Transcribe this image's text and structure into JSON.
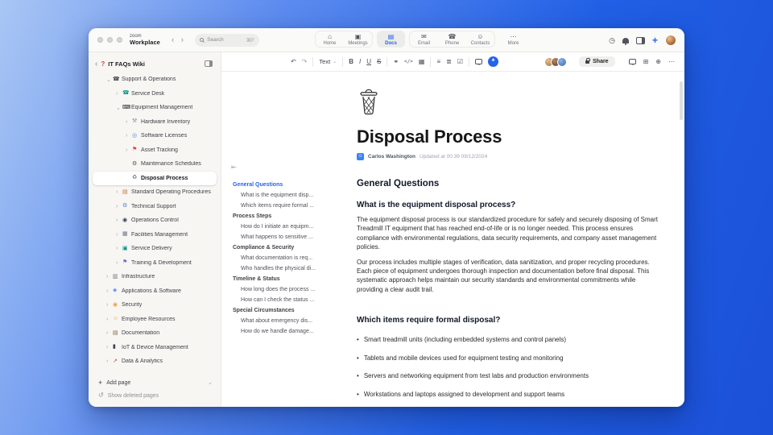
{
  "theme": {
    "accent": "#2563eb",
    "background_top": "#a9c6f4",
    "background_bottom": "#1b50d8"
  },
  "window": {
    "brand": {
      "top": "zoom",
      "bottom": "Workplace"
    },
    "search": {
      "label": "Search",
      "shortcut": "⌘F"
    },
    "nav_tabs": [
      {
        "label": "Home",
        "icon": "home-icon",
        "glyph": "⌂",
        "active": false,
        "group": 0
      },
      {
        "label": "Meetings",
        "icon": "meetings-icon",
        "glyph": "▣",
        "active": false,
        "group": 0
      },
      {
        "label": "Docs",
        "icon": "docs-icon",
        "glyph": "▤",
        "active": true,
        "group": 1
      },
      {
        "label": "Email",
        "icon": "email-icon",
        "glyph": "✉",
        "active": false,
        "group": 2
      },
      {
        "label": "Phone",
        "icon": "phone-icon",
        "glyph": "☎",
        "active": false,
        "group": 2
      },
      {
        "label": "Contacts",
        "icon": "contacts-icon",
        "glyph": "☺",
        "active": false,
        "group": 2
      },
      {
        "label": "More",
        "icon": "more-icon",
        "glyph": "⋯",
        "active": false,
        "group": 3
      }
    ]
  },
  "sidebar": {
    "title": "IT FAQs Wiki",
    "tree": [
      {
        "label": "Support & Operations",
        "depth": 0,
        "chevron": "expanded",
        "glyph": "☎",
        "color": "#3f3f46"
      },
      {
        "label": "Service Desk",
        "depth": 1,
        "chevron": "collapsed",
        "glyph": "☎",
        "color": "#0e9488"
      },
      {
        "label": "Equipment Management",
        "depth": 1,
        "chevron": "expanded",
        "glyph": "⌨",
        "color": "#27272a"
      },
      {
        "label": "Hardware Inventory",
        "depth": 2,
        "chevron": "collapsed",
        "glyph": "⚒",
        "color": "#8a8f98"
      },
      {
        "label": "Software Licenses",
        "depth": 2,
        "chevron": "collapsed",
        "glyph": "◎",
        "color": "#5b7fd4"
      },
      {
        "label": "Asset Tracking",
        "depth": 2,
        "chevron": "collapsed",
        "glyph": "⚑",
        "color": "#e0443a"
      },
      {
        "label": "Maintenance Schedules",
        "depth": 2,
        "chevron": "none",
        "glyph": "⚙",
        "color": "#52525b"
      },
      {
        "label": "Disposal Process",
        "depth": 2,
        "chevron": "none",
        "glyph": "♻",
        "color": "#6b7280",
        "selected": true
      },
      {
        "label": "Standard Operating Procedures",
        "depth": 1,
        "chevron": "collapsed",
        "glyph": "▤",
        "color": "#c2703d"
      },
      {
        "label": "Technical Support",
        "depth": 1,
        "chevron": "collapsed",
        "glyph": "⚙",
        "color": "#5b7fd4"
      },
      {
        "label": "Operations Control",
        "depth": 1,
        "chevron": "collapsed",
        "glyph": "◉",
        "color": "#374151"
      },
      {
        "label": "Facilities Management",
        "depth": 1,
        "chevron": "collapsed",
        "glyph": "▦",
        "color": "#64748b"
      },
      {
        "label": "Service Delivery",
        "depth": 1,
        "chevron": "collapsed",
        "glyph": "▣",
        "color": "#0e9488"
      },
      {
        "label": "Training & Development",
        "depth": 1,
        "chevron": "collapsed",
        "glyph": "⚑",
        "color": "#7c5cd6"
      },
      {
        "label": "Infrastructure",
        "depth": 0,
        "chevron": "collapsed",
        "glyph": "▥",
        "color": "#6b7280"
      },
      {
        "label": "Applications & Software",
        "depth": 0,
        "chevron": "collapsed",
        "glyph": "◈",
        "color": "#3b82f6"
      },
      {
        "label": "Security",
        "depth": 0,
        "chevron": "collapsed",
        "glyph": "◉",
        "color": "#e8a33d"
      },
      {
        "label": "Employee Resources",
        "depth": 0,
        "chevron": "collapsed",
        "glyph": "☺",
        "color": "#d9a520"
      },
      {
        "label": "Documentation",
        "depth": 0,
        "chevron": "collapsed",
        "glyph": "▤",
        "color": "#8b5e3c"
      },
      {
        "label": "IoT & Device Management",
        "depth": 0,
        "chevron": "collapsed",
        "glyph": "▮",
        "color": "#374151"
      },
      {
        "label": "Data & Analytics",
        "depth": 0,
        "chevron": "collapsed",
        "glyph": "↗",
        "color": "#e0443a"
      }
    ],
    "add_page": "Add page",
    "show_deleted": "Show deleted pages"
  },
  "toolbar": {
    "share_label": "Share",
    "items": [
      {
        "name": "undo-icon",
        "glyph": "↶"
      },
      {
        "name": "redo-icon",
        "glyph": "↷",
        "cls": "light"
      },
      {
        "type": "sep"
      },
      {
        "name": "text-style-dropdown",
        "type": "dropdown",
        "label": "Text",
        "chevron": "⌄"
      },
      {
        "type": "sep"
      },
      {
        "name": "bold-button",
        "glyph": "B",
        "cls": "b"
      },
      {
        "name": "italic-button",
        "glyph": "I",
        "cls": "i"
      },
      {
        "name": "underline-button",
        "glyph": "U",
        "cls": "u"
      },
      {
        "name": "strikethrough-button",
        "glyph": "S",
        "cls": "s"
      },
      {
        "type": "sep"
      },
      {
        "name": "link-button",
        "glyph": "⚭"
      },
      {
        "name": "code-button",
        "glyph": "</>",
        "cls": "code"
      },
      {
        "name": "insert-table-button",
        "glyph": "▦"
      },
      {
        "type": "sep"
      },
      {
        "name": "bulleted-list-button",
        "glyph": "≡"
      },
      {
        "name": "numbered-list-button",
        "glyph": "≣"
      },
      {
        "name": "checklist-button",
        "glyph": "☑"
      },
      {
        "type": "sep"
      },
      {
        "name": "comment-button",
        "type": "bubble"
      },
      {
        "name": "ai-assistant-button",
        "type": "ai",
        "glyph": "*"
      }
    ],
    "collaborators": [
      {
        "light": "#eec08e",
        "dark": "#9a6a3e"
      },
      {
        "light": "#b08868",
        "dark": "#5e3d26"
      },
      {
        "light": "#8ab4e8",
        "dark": "#3c6aa8"
      }
    ]
  },
  "toc": {
    "items": [
      {
        "label": "General Questions",
        "level": 0,
        "active": true
      },
      {
        "label": "What is the equipment disp...",
        "level": 1
      },
      {
        "label": "Which items require formal ...",
        "level": 1
      },
      {
        "label": "Process Steps",
        "level": 0
      },
      {
        "label": "How do I initiate an equipm...",
        "level": 1
      },
      {
        "label": "What happens to sensitive ...",
        "level": 1
      },
      {
        "label": "Compliance & Security",
        "level": 0
      },
      {
        "label": "What documentation is req...",
        "level": 1
      },
      {
        "label": "Who handles the physical di...",
        "level": 1
      },
      {
        "label": "Timeline & Status",
        "level": 0
      },
      {
        "label": "How long does the process ...",
        "level": 1
      },
      {
        "label": "How can I check the status ...",
        "level": 1
      },
      {
        "label": "Special Circumstances",
        "level": 0
      },
      {
        "label": "What about emergency dis...",
        "level": 1
      },
      {
        "label": "How do we handle damage...",
        "level": 1
      }
    ]
  },
  "doc": {
    "title": "Disposal Process",
    "author": "Carlos Washington",
    "updated": "Updated at 00:39 09/12/2024",
    "section_heading": "General Questions",
    "q1": "What is the equipment disposal process?",
    "p1": "The equipment disposal process is our standardized procedure for safely and securely disposing of Smart Treadmill IT equipment that has reached end-of-life or is no longer needed. This process ensures compliance with environmental regulations, data security requirements, and company asset management policies.",
    "p2": "Our process includes multiple stages of verification, data sanitization, and proper recycling procedures. Each piece of equipment undergoes thorough inspection and documentation before final disposal. This systematic approach helps maintain our security standards and environmental commitments while providing a clear audit trail.",
    "q2": "Which items require formal disposal?",
    "bullets": [
      "Smart treadmill units (including embedded systems and control panels)",
      "Tablets and mobile devices used for equipment testing and monitoring",
      "Servers and networking equipment from test labs and production environments",
      "Workstations and laptops assigned to development and support teams"
    ]
  }
}
